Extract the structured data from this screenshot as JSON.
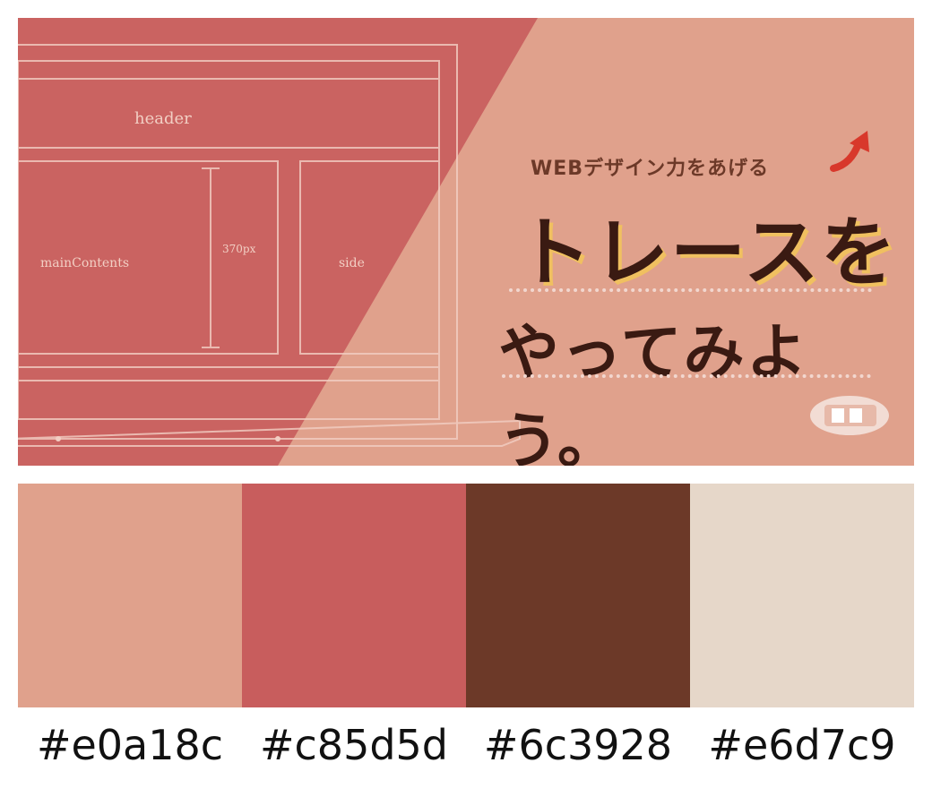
{
  "banner": {
    "tagline": "WEBデザイン力をあげる",
    "title_line1": "トレースを",
    "title_line2": "やってみよう。",
    "colors": {
      "light": "#e0a18c",
      "dark": "#c85d5d",
      "text": "#3a1a12",
      "accent_arrow": "#d8382b"
    },
    "icons": [
      "laptop-wireframe-illustration",
      "up-arrow-icon",
      "badge-icon"
    ]
  },
  "palette": {
    "swatches": [
      {
        "hex": "#e0a18c",
        "label": "#e0a18c"
      },
      {
        "hex": "#c85d5d",
        "label": "#c85d5d"
      },
      {
        "hex": "#6c3928",
        "label": "#6c3928"
      },
      {
        "hex": "#e6d7c9",
        "label": "#e6d7c9"
      }
    ]
  }
}
